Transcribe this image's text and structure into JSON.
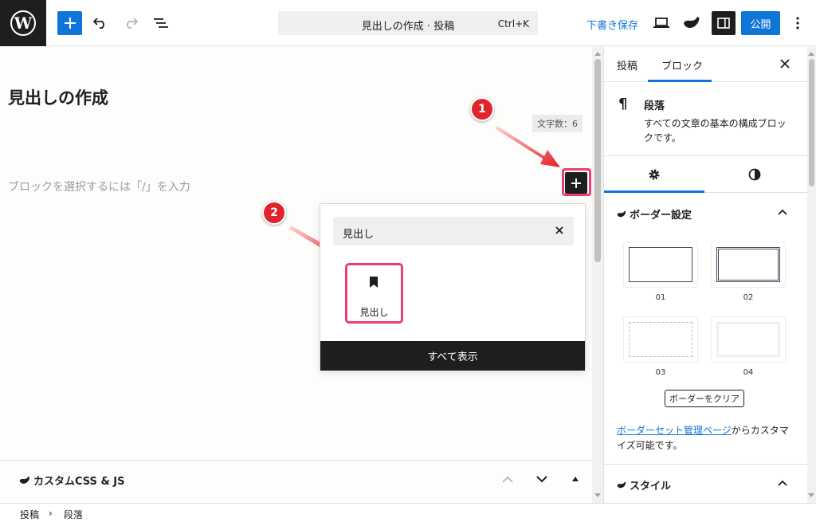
{
  "header": {
    "command_title": "見出しの作成 · 投稿",
    "shortcut": "Ctrl+K",
    "save_draft": "下書き保存",
    "publish": "公開"
  },
  "editor": {
    "post_title": "見出しの作成",
    "word_count": "文字数：6",
    "placeholder": "ブロックを選択するには「/」を入力"
  },
  "annotations": {
    "step1": "1",
    "step2": "2",
    "highlight_color": "#ea3e6f",
    "badge_color": "#e0242c"
  },
  "inserter": {
    "search_value": "見出し",
    "results": [
      {
        "label": "見出し",
        "icon": "bookmark-icon"
      }
    ],
    "browse_all": "すべて表示"
  },
  "meta_box": {
    "title": "カスタムCSS & JS"
  },
  "breadcrumb": {
    "items": [
      "投稿",
      "段落"
    ],
    "separator": "›"
  },
  "sidebar": {
    "tabs": [
      "投稿",
      "ブロック"
    ],
    "active_tab": "ブロック",
    "block": {
      "icon": "¶",
      "name": "段落",
      "description": "すべての文章の基本の構成ブロックです。"
    },
    "border_panel": {
      "title": "ボーダー設定",
      "options": [
        {
          "label": "01"
        },
        {
          "label": "02"
        },
        {
          "label": "03"
        },
        {
          "label": "04"
        }
      ],
      "clear_button": "ボーダーをクリア",
      "link_text": "ボーダーセット管理ページ",
      "suffix_text": "からカスタマイズ可能です。"
    },
    "style_panel": {
      "title": "スタイル"
    }
  },
  "colors": {
    "accent": "#1075d8",
    "dark": "#1e1e1e"
  }
}
